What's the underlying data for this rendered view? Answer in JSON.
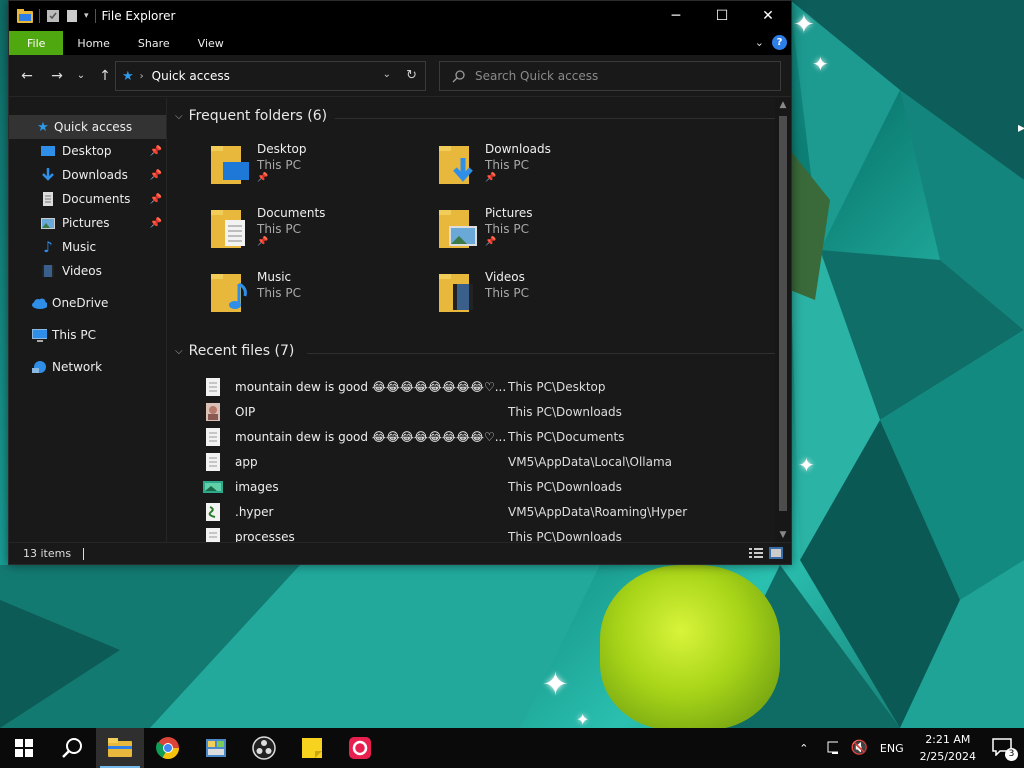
{
  "window": {
    "title": "File Explorer",
    "minimize": "─",
    "maximize": "☐",
    "close": "✕"
  },
  "ribbon": {
    "tabs": [
      "File",
      "Home",
      "Share",
      "View"
    ],
    "help": "?"
  },
  "address": {
    "crumb": "Quick access",
    "search_placeholder": "Search Quick access"
  },
  "sidebar": {
    "items": [
      {
        "label": "Quick access",
        "icon": "star-icon"
      },
      {
        "label": "Desktop",
        "icon": "desktop-icon",
        "pinned": true
      },
      {
        "label": "Downloads",
        "icon": "download-icon",
        "pinned": true
      },
      {
        "label": "Documents",
        "icon": "document-icon",
        "pinned": true
      },
      {
        "label": "Pictures",
        "icon": "picture-icon",
        "pinned": true
      },
      {
        "label": "Music",
        "icon": "music-icon"
      },
      {
        "label": "Videos",
        "icon": "video-icon"
      },
      {
        "label": "OneDrive",
        "icon": "cloud-icon"
      },
      {
        "label": "This PC",
        "icon": "computer-icon"
      },
      {
        "label": "Network",
        "icon": "network-icon"
      }
    ]
  },
  "frequent": {
    "header": "Frequent folders (6)",
    "folders": [
      {
        "name": "Desktop",
        "location": "This PC",
        "pinned": true
      },
      {
        "name": "Downloads",
        "location": "This PC",
        "pinned": true
      },
      {
        "name": "Documents",
        "location": "This PC",
        "pinned": true
      },
      {
        "name": "Pictures",
        "location": "This PC",
        "pinned": true
      },
      {
        "name": "Music",
        "location": "This PC",
        "pinned": false
      },
      {
        "name": "Videos",
        "location": "This PC",
        "pinned": false
      }
    ]
  },
  "recent": {
    "header": "Recent files (7)",
    "files": [
      {
        "name": "mountain dew is good 😂😂😂😂😂😂😂😂♡...",
        "path": "This PC\\Desktop",
        "icon": "text-file-icon"
      },
      {
        "name": "OIP",
        "path": "This PC\\Downloads",
        "icon": "image-file-icon"
      },
      {
        "name": "mountain dew is good 😂😂😂😂😂😂😂😂♡...",
        "path": "This PC\\Documents",
        "icon": "text-file-icon"
      },
      {
        "name": "app",
        "path": "VM5\\AppData\\Local\\Ollama",
        "icon": "text-file-icon"
      },
      {
        "name": "images",
        "path": "This PC\\Downloads",
        "icon": "image-folder-icon"
      },
      {
        "name": ".hyper",
        "path": "VM5\\AppData\\Roaming\\Hyper",
        "icon": "script-file-icon"
      },
      {
        "name": "processes",
        "path": "This PC\\Downloads",
        "icon": "text-file-icon"
      }
    ]
  },
  "status": {
    "items": "13 items"
  },
  "taskbar": {
    "language": "ENG",
    "time": "2:21 AM",
    "date": "2/25/2024",
    "notifications": "3"
  }
}
